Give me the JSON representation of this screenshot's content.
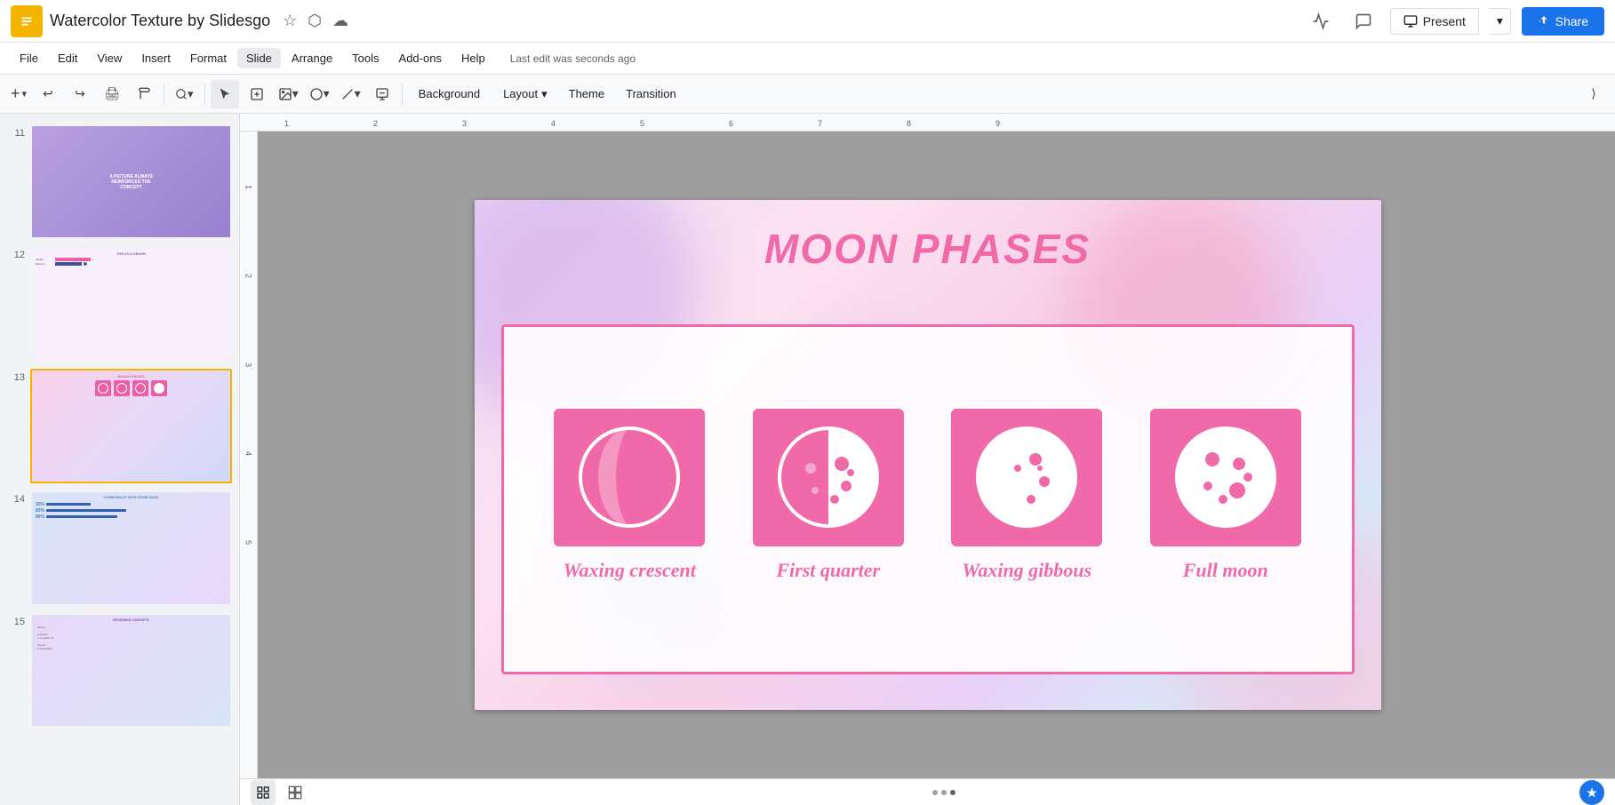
{
  "app": {
    "title": "Watercolor Texture by Slidesgo",
    "icon_color": "#f4b400"
  },
  "title_icons": [
    "☆",
    "⬡",
    "☁"
  ],
  "menu": {
    "items": [
      "File",
      "Edit",
      "View",
      "Insert",
      "Format",
      "Slide",
      "Arrange",
      "Tools",
      "Add-ons",
      "Help"
    ]
  },
  "last_edit": "Last edit was seconds ago",
  "toolbar": {
    "background_label": "Background",
    "layout_label": "Layout",
    "theme_label": "Theme",
    "transition_label": "Transition"
  },
  "present_btn": "Present",
  "share_btn": "Share",
  "slide": {
    "title": "MOON PHASES",
    "moons": [
      {
        "label": "Waxing crescent",
        "type": "waxing_crescent"
      },
      {
        "label": "First quarter",
        "type": "first_quarter"
      },
      {
        "label": "Waxing gibbous",
        "type": "waxing_gibbous"
      },
      {
        "label": "Full moon",
        "type": "full_moon"
      }
    ]
  },
  "slides_panel": {
    "slides": [
      {
        "num": "11",
        "type": "purple_text"
      },
      {
        "num": "12",
        "type": "graph"
      },
      {
        "num": "13",
        "type": "moon_phases",
        "active": true
      },
      {
        "num": "14",
        "type": "compatibility"
      },
      {
        "num": "15",
        "type": "reviewing"
      }
    ]
  },
  "bottom": {
    "dots": [
      false,
      false,
      true
    ]
  },
  "colors": {
    "pink": "#f06aaa",
    "accent": "#1a73e8",
    "gold": "#f4b400"
  }
}
